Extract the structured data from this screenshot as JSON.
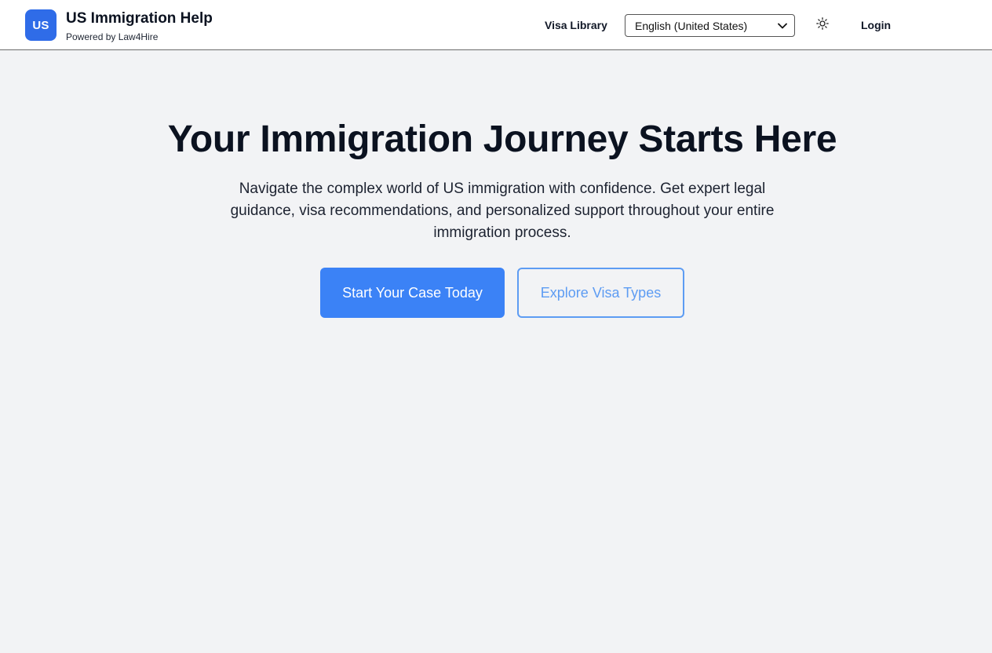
{
  "brand": {
    "badge": "US",
    "title": "US Immigration Help",
    "subtitle": "Powered by Law4Hire",
    "badge_color": "#2f6ce8"
  },
  "nav": {
    "visa_library": "Visa Library",
    "language_selected": "English (United States)",
    "theme_icon": "sun-icon",
    "login": "Login"
  },
  "hero": {
    "title": "Your Immigration Journey Starts Here",
    "subtitle": "Navigate the complex world of US immigration with confidence. Get expert legal guidance, visa recommendations, and personalized support throughout your entire immigration process.",
    "primary_button": "Start Your Case Today",
    "secondary_button": "Explore Visa Types",
    "primary_color": "#3b82f6",
    "secondary_color": "#5d9cf3"
  },
  "page": {
    "background": "#f2f3f5"
  }
}
